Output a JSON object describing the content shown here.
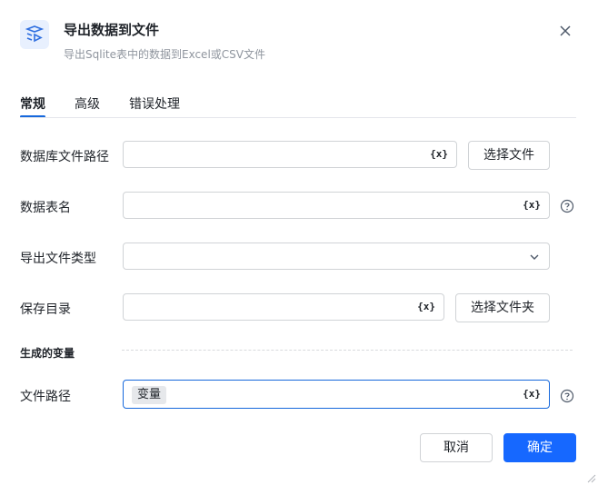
{
  "header": {
    "title": "导出数据到文件",
    "subtitle": "导出Sqlite表中的数据到Excel或CSV文件"
  },
  "tabs": [
    {
      "label": "常规",
      "active": true
    },
    {
      "label": "高级",
      "active": false
    },
    {
      "label": "错误处理",
      "active": false
    }
  ],
  "fields": {
    "db_path": {
      "label": "数据库文件路径",
      "value": "",
      "button": "选择文件"
    },
    "table_name": {
      "label": "数据表名",
      "value": ""
    },
    "file_type": {
      "label": "导出文件类型",
      "value": ""
    },
    "save_dir": {
      "label": "保存目录",
      "value": "",
      "button": "选择文件夹"
    }
  },
  "output_section": {
    "title": "生成的变量",
    "file_path": {
      "label": "文件路径",
      "tag": "变量"
    }
  },
  "variable_icon_text": "{x}",
  "footer": {
    "cancel": "取消",
    "confirm": "确定"
  },
  "colors": {
    "accent": "#1668ff",
    "tab_ink": "#1668dc"
  }
}
